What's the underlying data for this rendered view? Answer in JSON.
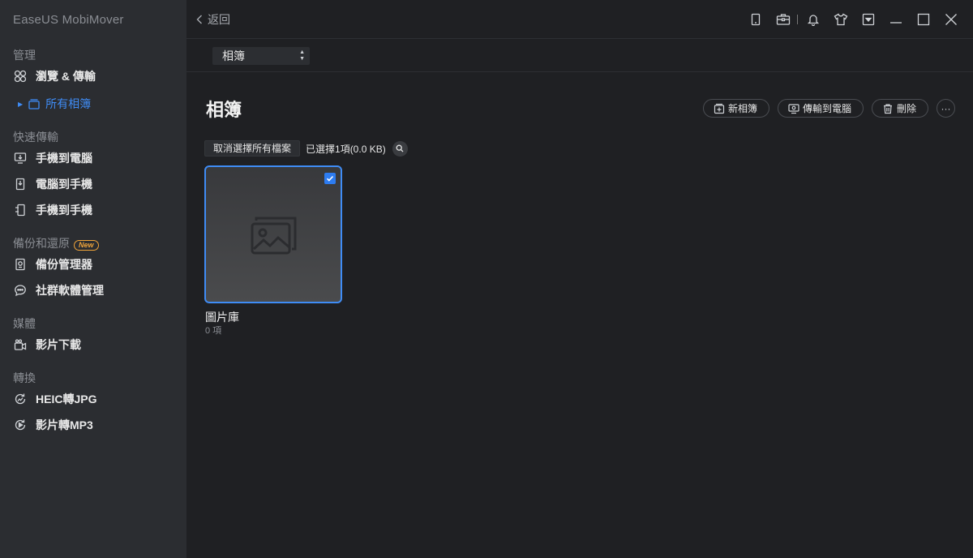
{
  "app": {
    "title": "EaseUS MobiMover"
  },
  "sidebar": {
    "sections": [
      {
        "title": "管理"
      },
      {
        "title": "快速傳輸"
      },
      {
        "title": "備份和還原",
        "badge": "New"
      },
      {
        "title": "媒體"
      },
      {
        "title": "轉換"
      }
    ],
    "manage": {
      "browse": {
        "label": "瀏覽 & 傳輸",
        "icon": "browse-grid-icon"
      },
      "all_albums": {
        "label": "所有相簿",
        "icon": "album-stack-icon"
      }
    },
    "quick": [
      {
        "label": "手機到電腦",
        "icon": "phone-to-pc-icon"
      },
      {
        "label": "電腦到手機",
        "icon": "pc-to-phone-icon"
      },
      {
        "label": "手機到手機",
        "icon": "phone-to-phone-icon"
      }
    ],
    "backup": [
      {
        "label": "備份管理器",
        "icon": "backup-manager-icon"
      },
      {
        "label": "社群軟體管理",
        "icon": "chat-bubble-icon"
      }
    ],
    "media": [
      {
        "label": "影片下載",
        "icon": "video-download-icon"
      }
    ],
    "convert": [
      {
        "label": "HEIC轉JPG",
        "icon": "heic-convert-icon"
      },
      {
        "label": "影片轉MP3",
        "icon": "video-to-mp3-icon"
      }
    ]
  },
  "topbar": {
    "back_label": "返回",
    "icons": [
      "device-icon",
      "toolbox-icon",
      "bell-icon",
      "shirt-icon",
      "menu-dropdown-icon",
      "minimize-icon",
      "maximize-icon",
      "close-icon"
    ]
  },
  "filter": {
    "selected": "相簿"
  },
  "main": {
    "title": "相簿",
    "actions": {
      "new_album": "新相簿",
      "transfer_to_pc": "傳輸到電腦",
      "delete": "刪除",
      "more": "···"
    },
    "deselect_label": "取消選擇所有檔案",
    "selection_status": "已選擇1項(0.0 KB)"
  },
  "albums": [
    {
      "name": "圖片庫",
      "count": "0 項",
      "selected": true
    }
  ],
  "colors": {
    "accent": "#3f8cf5",
    "sidebar_bg": "#2b2d31",
    "main_bg": "#1f2023",
    "badge": "#f0a43a"
  }
}
